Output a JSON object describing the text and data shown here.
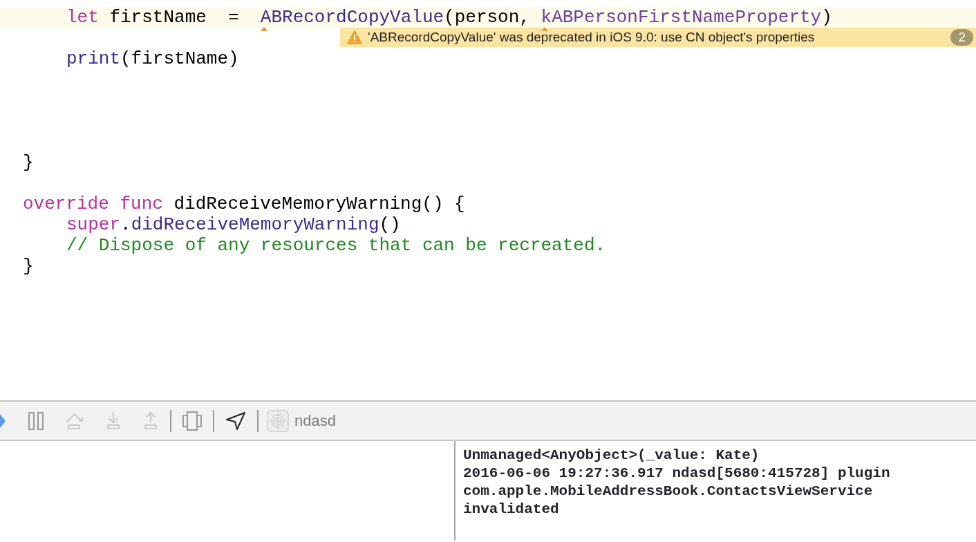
{
  "editor": {
    "lines": [
      {
        "kind": "code",
        "current": true,
        "indented": true,
        "tokens": [
          {
            "kind": "keyword",
            "text": "let"
          },
          {
            "kind": "plain",
            "text": " firstName  =  "
          },
          {
            "kind": "function",
            "text": "ABRecordCopyValue",
            "marked": true
          },
          {
            "kind": "plain",
            "text": "(person, "
          },
          {
            "kind": "constant",
            "text": "kABPersonFirstNameProperty",
            "marked": true
          },
          {
            "kind": "plain",
            "text": ")"
          }
        ]
      },
      {
        "kind": "warning",
        "message": "'ABRecordCopyValue' was deprecated in iOS 9.0: use CN object's properties",
        "count": "2"
      },
      {
        "kind": "code",
        "current": false,
        "indented": true,
        "tokens": [
          {
            "kind": "function",
            "text": "print"
          },
          {
            "kind": "plain",
            "text": "(firstName)"
          }
        ]
      },
      {
        "kind": "blank"
      },
      {
        "kind": "blank"
      },
      {
        "kind": "blank"
      },
      {
        "kind": "blank"
      },
      {
        "kind": "code",
        "current": false,
        "indented": false,
        "tokens": [
          {
            "kind": "plain",
            "text": "}"
          }
        ]
      },
      {
        "kind": "blank"
      },
      {
        "kind": "code",
        "current": false,
        "indented": false,
        "tokens": [
          {
            "kind": "keyword",
            "text": "override"
          },
          {
            "kind": "keyword",
            "text": " func"
          },
          {
            "kind": "plain",
            "text": " didReceiveMemoryWarning() {"
          }
        ]
      },
      {
        "kind": "code",
        "current": false,
        "indented": true,
        "tokens": [
          {
            "kind": "keyword",
            "text": "super"
          },
          {
            "kind": "plain",
            "text": "."
          },
          {
            "kind": "function",
            "text": "didReceiveMemoryWarning"
          },
          {
            "kind": "plain",
            "text": "()"
          }
        ]
      },
      {
        "kind": "code",
        "current": false,
        "indented": true,
        "tokens": [
          {
            "kind": "comment",
            "text": "// Dispose of any resources that can be recreated."
          }
        ]
      },
      {
        "kind": "code",
        "current": false,
        "indented": false,
        "tokens": [
          {
            "kind": "plain",
            "text": "}"
          }
        ]
      }
    ]
  },
  "debug_bar": {
    "groups": [
      [
        {
          "kind": "continue",
          "disabled": false
        },
        {
          "kind": "pause",
          "disabled": false
        },
        {
          "kind": "step-over",
          "disabled": true
        },
        {
          "kind": "step-into",
          "disabled": true
        },
        {
          "kind": "step-out",
          "disabled": true
        }
      ],
      [
        {
          "kind": "view-debug",
          "disabled": false
        }
      ],
      [
        {
          "kind": "location",
          "disabled": false
        }
      ]
    ],
    "target": {
      "label": "ndasd"
    }
  },
  "console": {
    "lines": [
      "Unmanaged<AnyObject>(_value: Kate)",
      "2016-06-06 19:27:36.917 ndasd[5680:415728] plugin",
      "com.apple.MobileAddressBook.ContactsViewService",
      "invalidated"
    ]
  }
}
